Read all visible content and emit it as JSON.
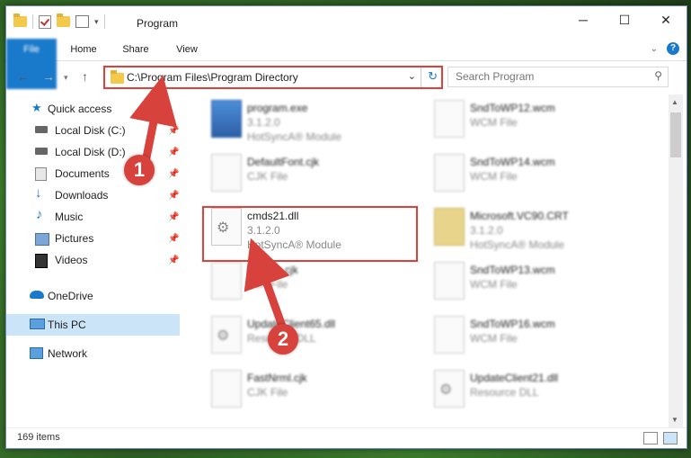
{
  "window": {
    "title": "Program",
    "controls": {
      "minimize": "─",
      "maximize": "☐",
      "close": "✕"
    }
  },
  "ribbon": {
    "tabs": [
      "File",
      "Home",
      "Share",
      "View"
    ]
  },
  "address": {
    "path": "C:\\Program Files\\Program Directory",
    "dropdown_icon": "chevron-down-icon",
    "refresh_icon": "refresh-icon"
  },
  "search": {
    "placeholder": "Search Program"
  },
  "sidebar": {
    "items": [
      {
        "label": "Quick access",
        "icon": "star-icon"
      },
      {
        "label": "Local Disk (C:)",
        "icon": "drive-icon",
        "pinned": true
      },
      {
        "label": "Local Disk (D:)",
        "icon": "drive-icon",
        "pinned": true
      },
      {
        "label": "Documents",
        "icon": "documents-icon",
        "pinned": true
      },
      {
        "label": "Downloads",
        "icon": "downloads-icon",
        "pinned": true
      },
      {
        "label": "Music",
        "icon": "music-icon",
        "pinned": true
      },
      {
        "label": "Pictures",
        "icon": "pictures-icon",
        "pinned": true
      },
      {
        "label": "Videos",
        "icon": "videos-icon",
        "pinned": true
      },
      {
        "label": "OneDrive",
        "icon": "cloud-icon"
      },
      {
        "label": "This PC",
        "icon": "computer-icon",
        "selected": true
      },
      {
        "label": "Network",
        "icon": "network-icon"
      }
    ]
  },
  "files": [
    {
      "name": "program.exe",
      "line2": "3.1.2.0",
      "line3": "HotSyncA® Module",
      "kind": "exe"
    },
    {
      "name": "SndToWP12.wcm",
      "line2": "WCM File",
      "line3": "",
      "kind": "doc"
    },
    {
      "name": "DefaultFont.cjk",
      "line2": "CJK File",
      "line3": "",
      "kind": "doc"
    },
    {
      "name": "SndToWP14.wcm",
      "line2": "WCM File",
      "line3": "",
      "kind": "doc"
    },
    {
      "name": "cmds21.dll",
      "line2": "3.1.2.0",
      "line3": "HotSyncA® Module",
      "kind": "dll"
    },
    {
      "name": "Microsoft.VC90.CRT",
      "line2": "3.1.2.0",
      "line3": "HotSyncA® Module",
      "kind": "crt"
    },
    {
      "name": "Korean.cjk",
      "line2": "CJK File",
      "line3": "",
      "kind": "doc"
    },
    {
      "name": "SndToWP13.wcm",
      "line2": "WCM File",
      "line3": "",
      "kind": "doc"
    },
    {
      "name": "UpdateClient65.dll",
      "line2": "Resource DLL",
      "line3": "",
      "kind": "dll"
    },
    {
      "name": "SndToWP16.wcm",
      "line2": "WCM File",
      "line3": "",
      "kind": "doc"
    },
    {
      "name": "FastNrml.cjk",
      "line2": "CJK File",
      "line3": "",
      "kind": "doc"
    },
    {
      "name": "UpdateClient21.dll",
      "line2": "Resource DLL",
      "line3": "",
      "kind": "dll"
    }
  ],
  "status": {
    "item_count": "169 items"
  },
  "callouts": [
    "1",
    "2"
  ],
  "colors": {
    "accent": "#1979ca",
    "highlight": "#e0403a",
    "selected": "#cce4f7"
  }
}
